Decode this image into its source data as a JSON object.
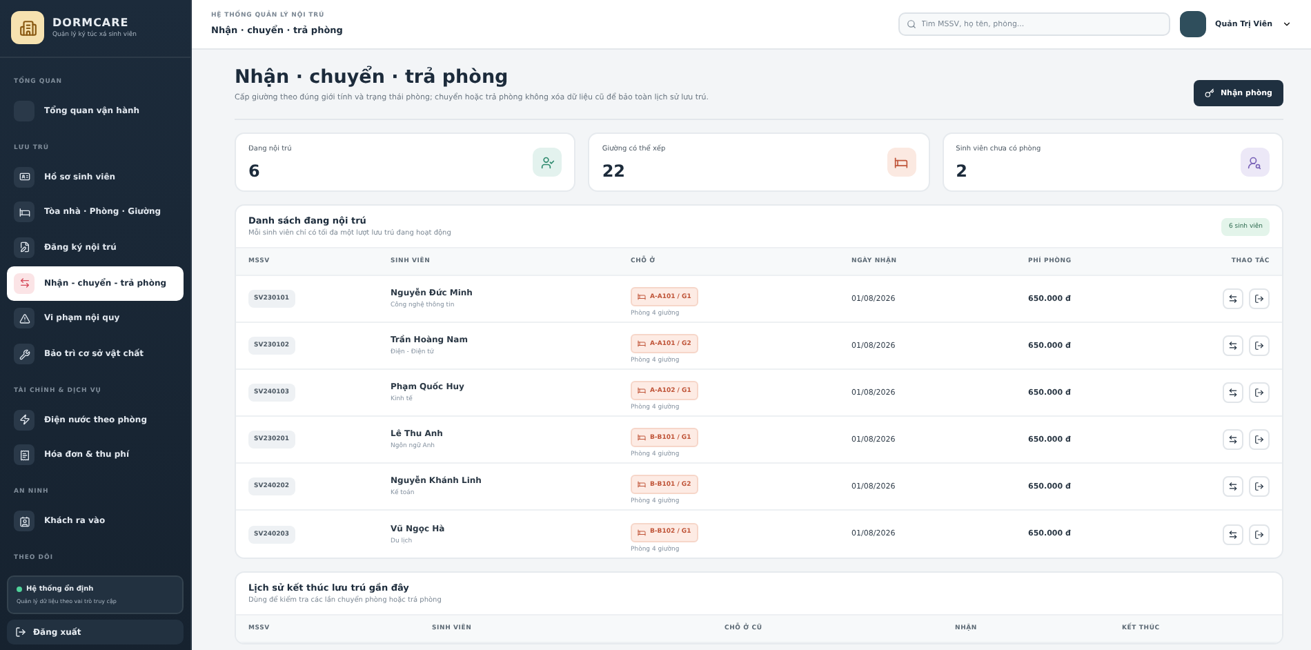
{
  "brand": {
    "name": "DORMCARE",
    "tagline": "Quản lý ký túc xá sinh viên"
  },
  "nav": [
    {
      "label": "TỔNG QUAN",
      "items": [
        {
          "label": "Tổng quan vận hành",
          "selected": false
        }
      ]
    },
    {
      "label": "LƯU TRÚ",
      "items": [
        {
          "label": "Hồ sơ sinh viên",
          "selected": false
        },
        {
          "label": "Tòa nhà · Phòng · Giường",
          "selected": false
        },
        {
          "label": "Đăng ký nội trú",
          "selected": false
        },
        {
          "label": "Nhận - chuyển - trả phòng",
          "selected": true
        },
        {
          "label": "Vi phạm nội quy",
          "selected": false
        },
        {
          "label": "Bảo trì cơ sở vật chất",
          "selected": false
        }
      ]
    },
    {
      "label": "TÀI CHÍNH & DỊCH VỤ",
      "items": [
        {
          "label": "Điện nước theo phòng",
          "selected": false
        },
        {
          "label": "Hóa đơn & thu phí",
          "selected": false
        }
      ]
    },
    {
      "label": "AN NINH",
      "items": [
        {
          "label": "Khách ra vào",
          "selected": false
        }
      ]
    },
    {
      "label": "THEO DÕI"
    }
  ],
  "status": {
    "label": "Hệ thống ổn định",
    "sub": "Quản lý dữ liệu theo vai trò truy cập",
    "on": true
  },
  "logout": "Đăng xuất",
  "topbar": {
    "eyebrow": "HỆ THỐNG QUẢN LÝ NỘI TRÚ",
    "title": "Nhận · chuyển · trả phòng",
    "search_placeholder": "Tìm MSSV, họ tên, phòng...",
    "user": "Quản Trị Viên"
  },
  "page": {
    "title": "Nhận · chuyển · trả phòng",
    "subtitle": "Cấp giường theo đúng giới tính và trạng thái phòng; chuyển hoặc trả phòng không xóa dữ liệu cũ để bảo toàn lịch sử lưu trú.",
    "button": "Nhận phòng"
  },
  "stats": [
    {
      "label": "Đang nội trú",
      "value": "6",
      "color": "#e3f2ee"
    },
    {
      "label": "Giường có thể xếp",
      "value": "22",
      "color": "#fbe9e1"
    },
    {
      "label": "Sinh viên chưa có phòng",
      "value": "2",
      "color": "#ece8f7"
    }
  ],
  "residents": {
    "title": "Danh sách đang nội trú",
    "subtitle": "Mỗi sinh viên chỉ có tối đa một lượt lưu trú đang hoạt động",
    "badge": "6 sinh viên",
    "columns": [
      "MSSV",
      "SINH VIÊN",
      "CHỖ Ở",
      "NGÀY NHẬN",
      "PHÍ PHÒNG",
      "THAO TÁC"
    ],
    "rows": [
      {
        "mssv": "SV230101",
        "name": "Nguyễn Đức Minh",
        "major": "Công nghệ thông tin",
        "bed": "A-A101 / G1",
        "room": "Phòng 4 giường",
        "date": "01/08/2026",
        "fee": "650.000 đ"
      },
      {
        "mssv": "SV230102",
        "name": "Trần Hoàng Nam",
        "major": "Điện - Điện tử",
        "bed": "A-A101 / G2",
        "room": "Phòng 4 giường",
        "date": "01/08/2026",
        "fee": "650.000 đ"
      },
      {
        "mssv": "SV240103",
        "name": "Phạm Quốc Huy",
        "major": "Kinh tế",
        "bed": "A-A102 / G1",
        "room": "Phòng 4 giường",
        "date": "01/08/2026",
        "fee": "650.000 đ"
      },
      {
        "mssv": "SV230201",
        "name": "Lê Thu Anh",
        "major": "Ngôn ngữ Anh",
        "bed": "B-B101 / G1",
        "room": "Phòng 4 giường",
        "date": "01/08/2026",
        "fee": "650.000 đ"
      },
      {
        "mssv": "SV240202",
        "name": "Nguyễn Khánh Linh",
        "major": "Kế toán",
        "bed": "B-B101 / G2",
        "room": "Phòng 4 giường",
        "date": "01/08/2026",
        "fee": "650.000 đ"
      },
      {
        "mssv": "SV240203",
        "name": "Vũ Ngọc Hà",
        "major": "Du lịch",
        "bed": "B-B102 / G1",
        "room": "Phòng 4 giường",
        "date": "01/08/2026",
        "fee": "650.000 đ"
      }
    ]
  },
  "history": {
    "title": "Lịch sử kết thúc lưu trú gần đây",
    "subtitle": "Dùng để kiểm tra các lần chuyển phòng hoặc trả phòng",
    "columns": [
      "MSSV",
      "SINH VIÊN",
      "CHỖ Ở CŨ",
      "NHẬN",
      "KẾT THÚC"
    ]
  }
}
